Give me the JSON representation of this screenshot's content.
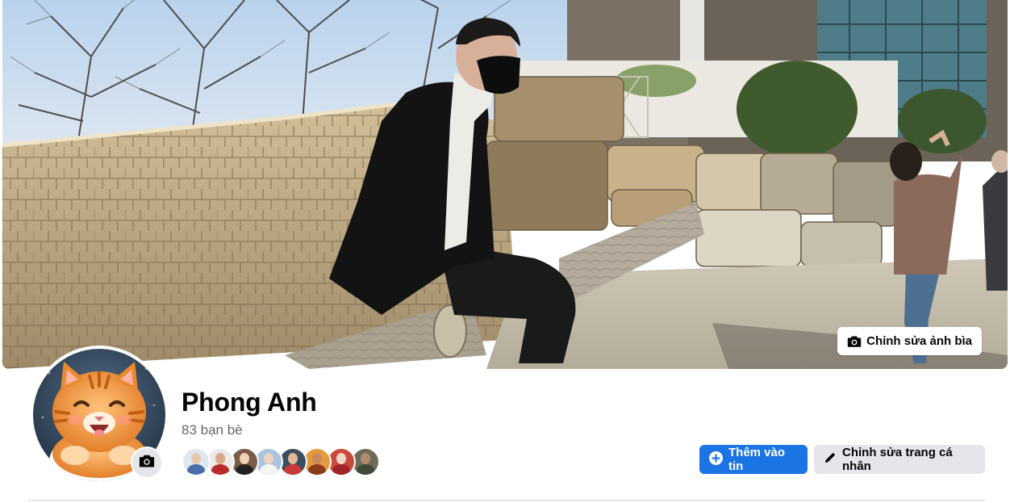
{
  "cover": {
    "edit_label": "Chỉnh sửa ảnh bìa",
    "icon": "camera-icon"
  },
  "profile": {
    "name": "Phong Anh",
    "friend_count": "83 bạn bè",
    "avatar_icon": "camera-icon"
  },
  "friends": [
    {
      "skin": "#e8c9b0",
      "shirt": "#4a6ea8",
      "bg": "#dfe8f0"
    },
    {
      "skin": "#d9a888",
      "shirt": "#b82a2a",
      "bg": "#eaeaea"
    },
    {
      "skin": "#f0d0b8",
      "shirt": "#222222",
      "bg": "#7a5c48"
    },
    {
      "skin": "#ecd2c0",
      "shirt": "#f4f4f4",
      "bg": "#a9c4de"
    },
    {
      "skin": "#e0b89a",
      "shirt": "#c83a3a",
      "bg": "#3a4e5e"
    },
    {
      "skin": "#c48a5e",
      "shirt": "#8a3b1c",
      "bg": "#e59a3c"
    },
    {
      "skin": "#f2d6c6",
      "shirt": "#a0242a",
      "bg": "#c94a3c"
    },
    {
      "skin": "#b08c6c",
      "shirt": "#3e4a36",
      "bg": "#6f6a58"
    }
  ],
  "actions": {
    "add_story": "Thêm vào tin",
    "edit_profile": "Chỉnh sửa trang cá nhân"
  },
  "colors": {
    "primary": "#1b74e4",
    "secondary_bg": "#e4e6eb",
    "muted_text": "#65676b"
  }
}
